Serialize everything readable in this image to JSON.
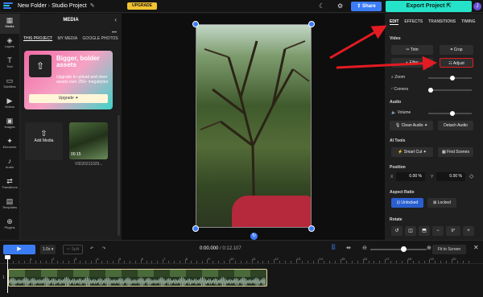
{
  "topbar": {
    "folder": "New Folder",
    "project": "Studio Project",
    "edit_icon": "pencil-icon",
    "upgrade": "UPGRADE",
    "share": "Share",
    "export": "Export Project",
    "avatar_initial": "J"
  },
  "rail": [
    {
      "label": "Media",
      "icon": "media-icon"
    },
    {
      "label": "Layers",
      "icon": "layers-icon"
    },
    {
      "label": "Text",
      "icon": "text-icon"
    },
    {
      "label": "Subtitles",
      "icon": "subtitles-icon"
    },
    {
      "label": "Videos",
      "icon": "videos-icon"
    },
    {
      "label": "Images",
      "icon": "images-icon"
    },
    {
      "label": "Elements",
      "icon": "elements-icon"
    },
    {
      "label": "Audio",
      "icon": "audio-icon"
    },
    {
      "label": "Transitions",
      "icon": "transitions-icon"
    },
    {
      "label": "Templates",
      "icon": "templates-icon"
    },
    {
      "label": "Plugins",
      "icon": "plugins-icon"
    }
  ],
  "media": {
    "title": "MEDIA",
    "tabs": [
      "THIS PROJECT",
      "MY MEDIA",
      "GOOGLE PHOTOS"
    ],
    "promo_heading": "Bigger, bolder assets",
    "promo_text": "Upgrade to upload and store assets over 250+ megabytes",
    "promo_button": "Upgrade",
    "add_media": "Add Media",
    "clip_duration": "00:15",
    "clip_name": "VID20211029..."
  },
  "props": {
    "tabs": [
      "EDIT",
      "EFFECTS",
      "TRANSITIONS",
      "TIMING"
    ],
    "video_section": "Video",
    "trim": "Trim",
    "crop": "Crop",
    "filter": "Filter",
    "adjust": "Adjust",
    "zoom": "Zoom",
    "corners": "Corners",
    "audio_section": "Audio",
    "volume": "Volume",
    "clean_audio": "Clean Audio",
    "detach_audio": "Detach Audio",
    "ai_section": "AI Tools",
    "smart_cut": "Smart Cut",
    "find_scenes": "Find Scenes",
    "position_section": "Position",
    "pos_x_label": "X",
    "pos_x": "0.00",
    "pos_y_label": "Y",
    "pos_y": "0.00",
    "pos_unit": "%",
    "aspect_section": "Aspect Ratio",
    "unlocked": "Unlocked",
    "locked": "Locked",
    "rotate_section": "Rotate",
    "zoom_level": 0.55,
    "volume_level": 0.55
  },
  "timeline": {
    "speed": "1.0x",
    "split": "Split",
    "time_current": "0:00.000",
    "time_total": "0:12.107",
    "fit": "Fit to Screen",
    "ticks": [
      "0",
      "1",
      "2",
      "3",
      "4",
      "5",
      "6",
      "7",
      "8",
      "9",
      "10",
      "11",
      "12",
      "13",
      "14",
      "15",
      "16",
      "17",
      "18",
      "19",
      "20"
    ],
    "track_number": "1"
  }
}
